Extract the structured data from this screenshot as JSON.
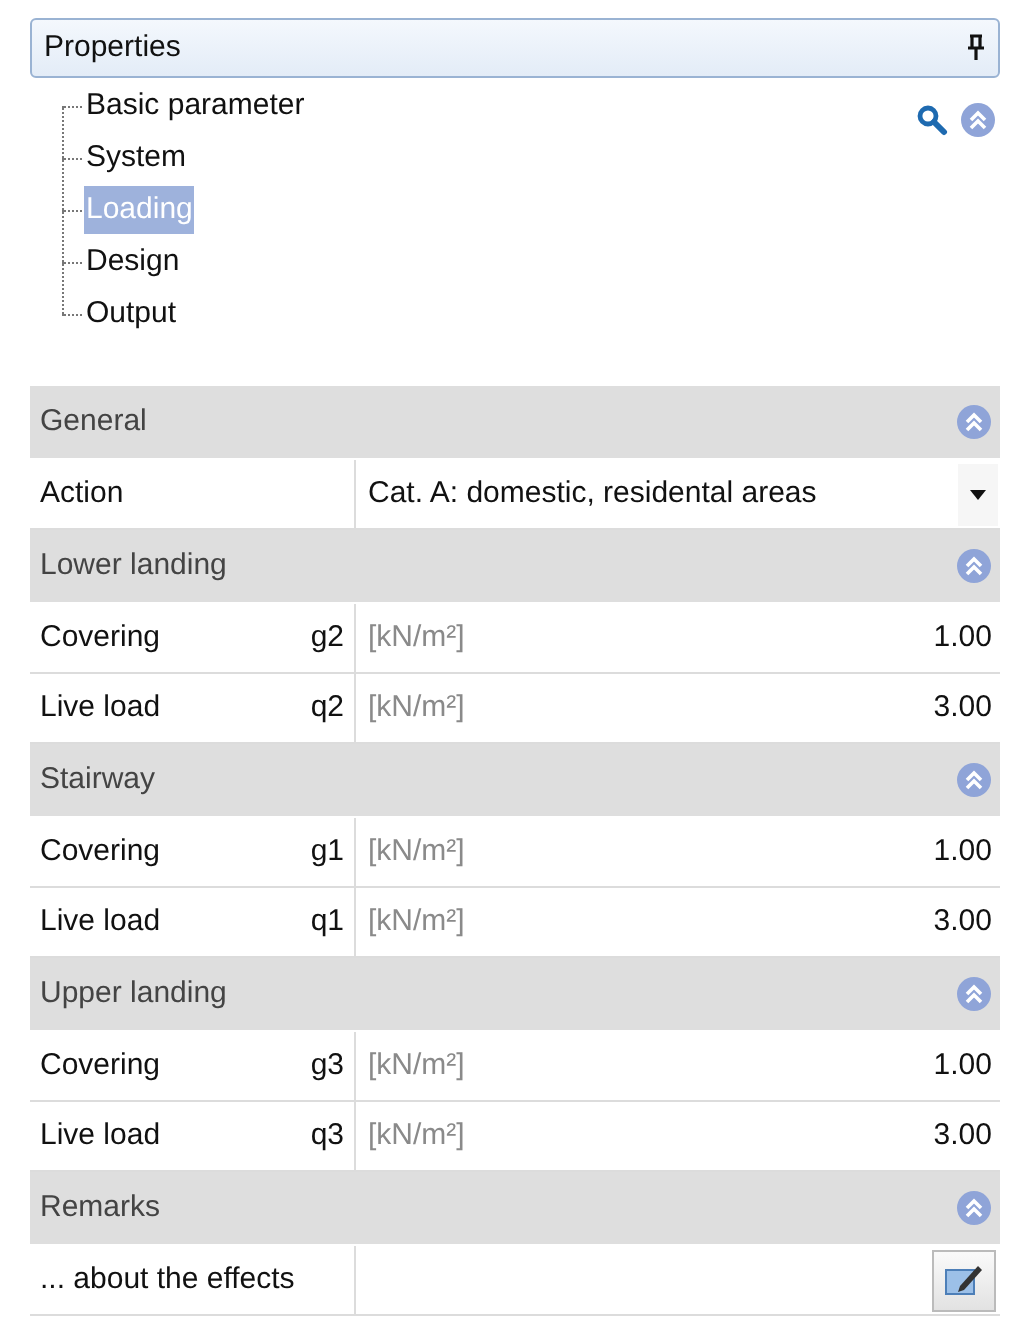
{
  "panel": {
    "title": "Properties"
  },
  "tree": [
    {
      "label": "Basic parameter",
      "selected": false
    },
    {
      "label": "System",
      "selected": false
    },
    {
      "label": "Loading",
      "selected": true
    },
    {
      "label": "Design",
      "selected": false
    },
    {
      "label": "Output",
      "selected": false
    }
  ],
  "sections": [
    {
      "title": "General",
      "expanded": true,
      "rows": [
        {
          "kind": "dropdown",
          "label": "Action",
          "value": "Cat. A: domestic, residental areas"
        }
      ]
    },
    {
      "title": "Lower landing",
      "expanded": true,
      "rows": [
        {
          "kind": "quantity",
          "label": "Covering",
          "symbol": "g2",
          "unit": "[kN/m²]",
          "value": "1.00"
        },
        {
          "kind": "quantity",
          "label": "Live load",
          "symbol": "q2",
          "unit": "[kN/m²]",
          "value": "3.00"
        }
      ]
    },
    {
      "title": "Stairway",
      "expanded": true,
      "rows": [
        {
          "kind": "quantity",
          "label": "Covering",
          "symbol": "g1",
          "unit": "[kN/m²]",
          "value": "1.00"
        },
        {
          "kind": "quantity",
          "label": "Live load",
          "symbol": "q1",
          "unit": "[kN/m²]",
          "value": "3.00"
        }
      ]
    },
    {
      "title": "Upper landing",
      "expanded": true,
      "rows": [
        {
          "kind": "quantity",
          "label": "Covering",
          "symbol": "g3",
          "unit": "[kN/m²]",
          "value": "1.00"
        },
        {
          "kind": "quantity",
          "label": "Live load",
          "symbol": "q3",
          "unit": "[kN/m²]",
          "value": "3.00"
        }
      ]
    },
    {
      "title": "Remarks",
      "expanded": true,
      "rows": [
        {
          "kind": "editor",
          "label": "... about the effects"
        }
      ]
    }
  ]
}
